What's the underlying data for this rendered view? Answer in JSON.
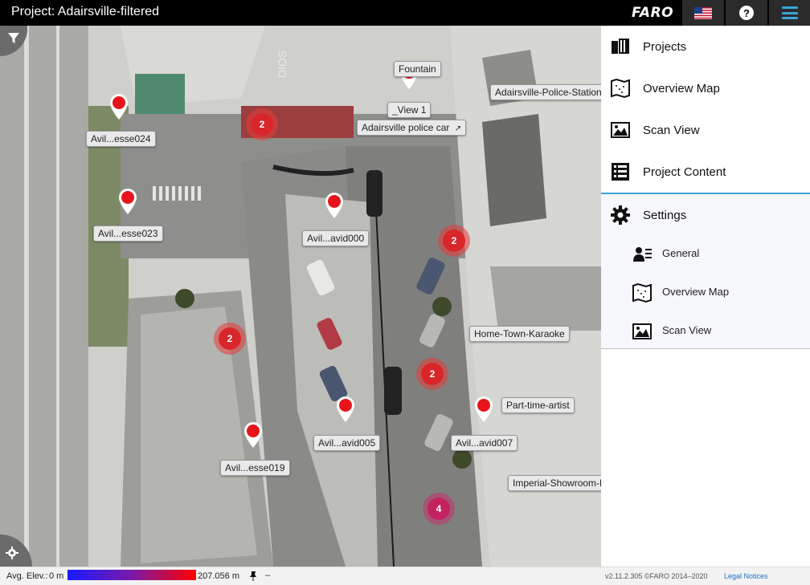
{
  "app": {
    "title": "Project: Adairsville-filtered",
    "logo": "FARO",
    "flag_icon": "us-flag-icon",
    "help_icon": "question-mark-icon",
    "menu_icon": "hamburger-menu-icon",
    "accent_color": "#3aa4d8"
  },
  "map": {
    "pins": [
      {
        "label": "Avil...esse024"
      },
      {
        "label": "Avil...esse023"
      },
      {
        "label": "Avil...avid000"
      },
      {
        "label": "Avil...avid005"
      },
      {
        "label": "Avil...avid007"
      },
      {
        "label": "Avil...esse019"
      },
      {
        "label": "_View 1"
      }
    ],
    "callouts": [
      "Fountain",
      "Adairsville-Police-Station",
      "Adairsville police car",
      "Home-Town-Karaoke",
      "Part-time-artist",
      "Imperial-Showroom-E"
    ],
    "clusters": [
      "2",
      "2",
      "2",
      "2",
      "4"
    ],
    "road_text": "DIOS"
  },
  "sidebar": {
    "items": [
      {
        "label": "Projects",
        "icon": "projects-icon"
      },
      {
        "label": "Overview Map",
        "icon": "overview-map-icon"
      },
      {
        "label": "Scan View",
        "icon": "scan-view-icon"
      },
      {
        "label": "Project Content",
        "icon": "project-content-icon"
      },
      {
        "label": "Settings",
        "icon": "gear-icon"
      }
    ],
    "settings_sub": [
      {
        "label": "General",
        "icon": "user-settings-icon"
      },
      {
        "label": "Overview Map",
        "icon": "overview-map-icon"
      },
      {
        "label": "Scan View",
        "icon": "scan-view-icon"
      }
    ]
  },
  "bottom": {
    "elev_label": "Avg. Elev.:",
    "elev_min": "0 m",
    "elev_max": "207.056 m",
    "dash": "–",
    "version": "v2.11.2.305  ©FARO 2014–2020",
    "legal": "Legal Notices"
  }
}
